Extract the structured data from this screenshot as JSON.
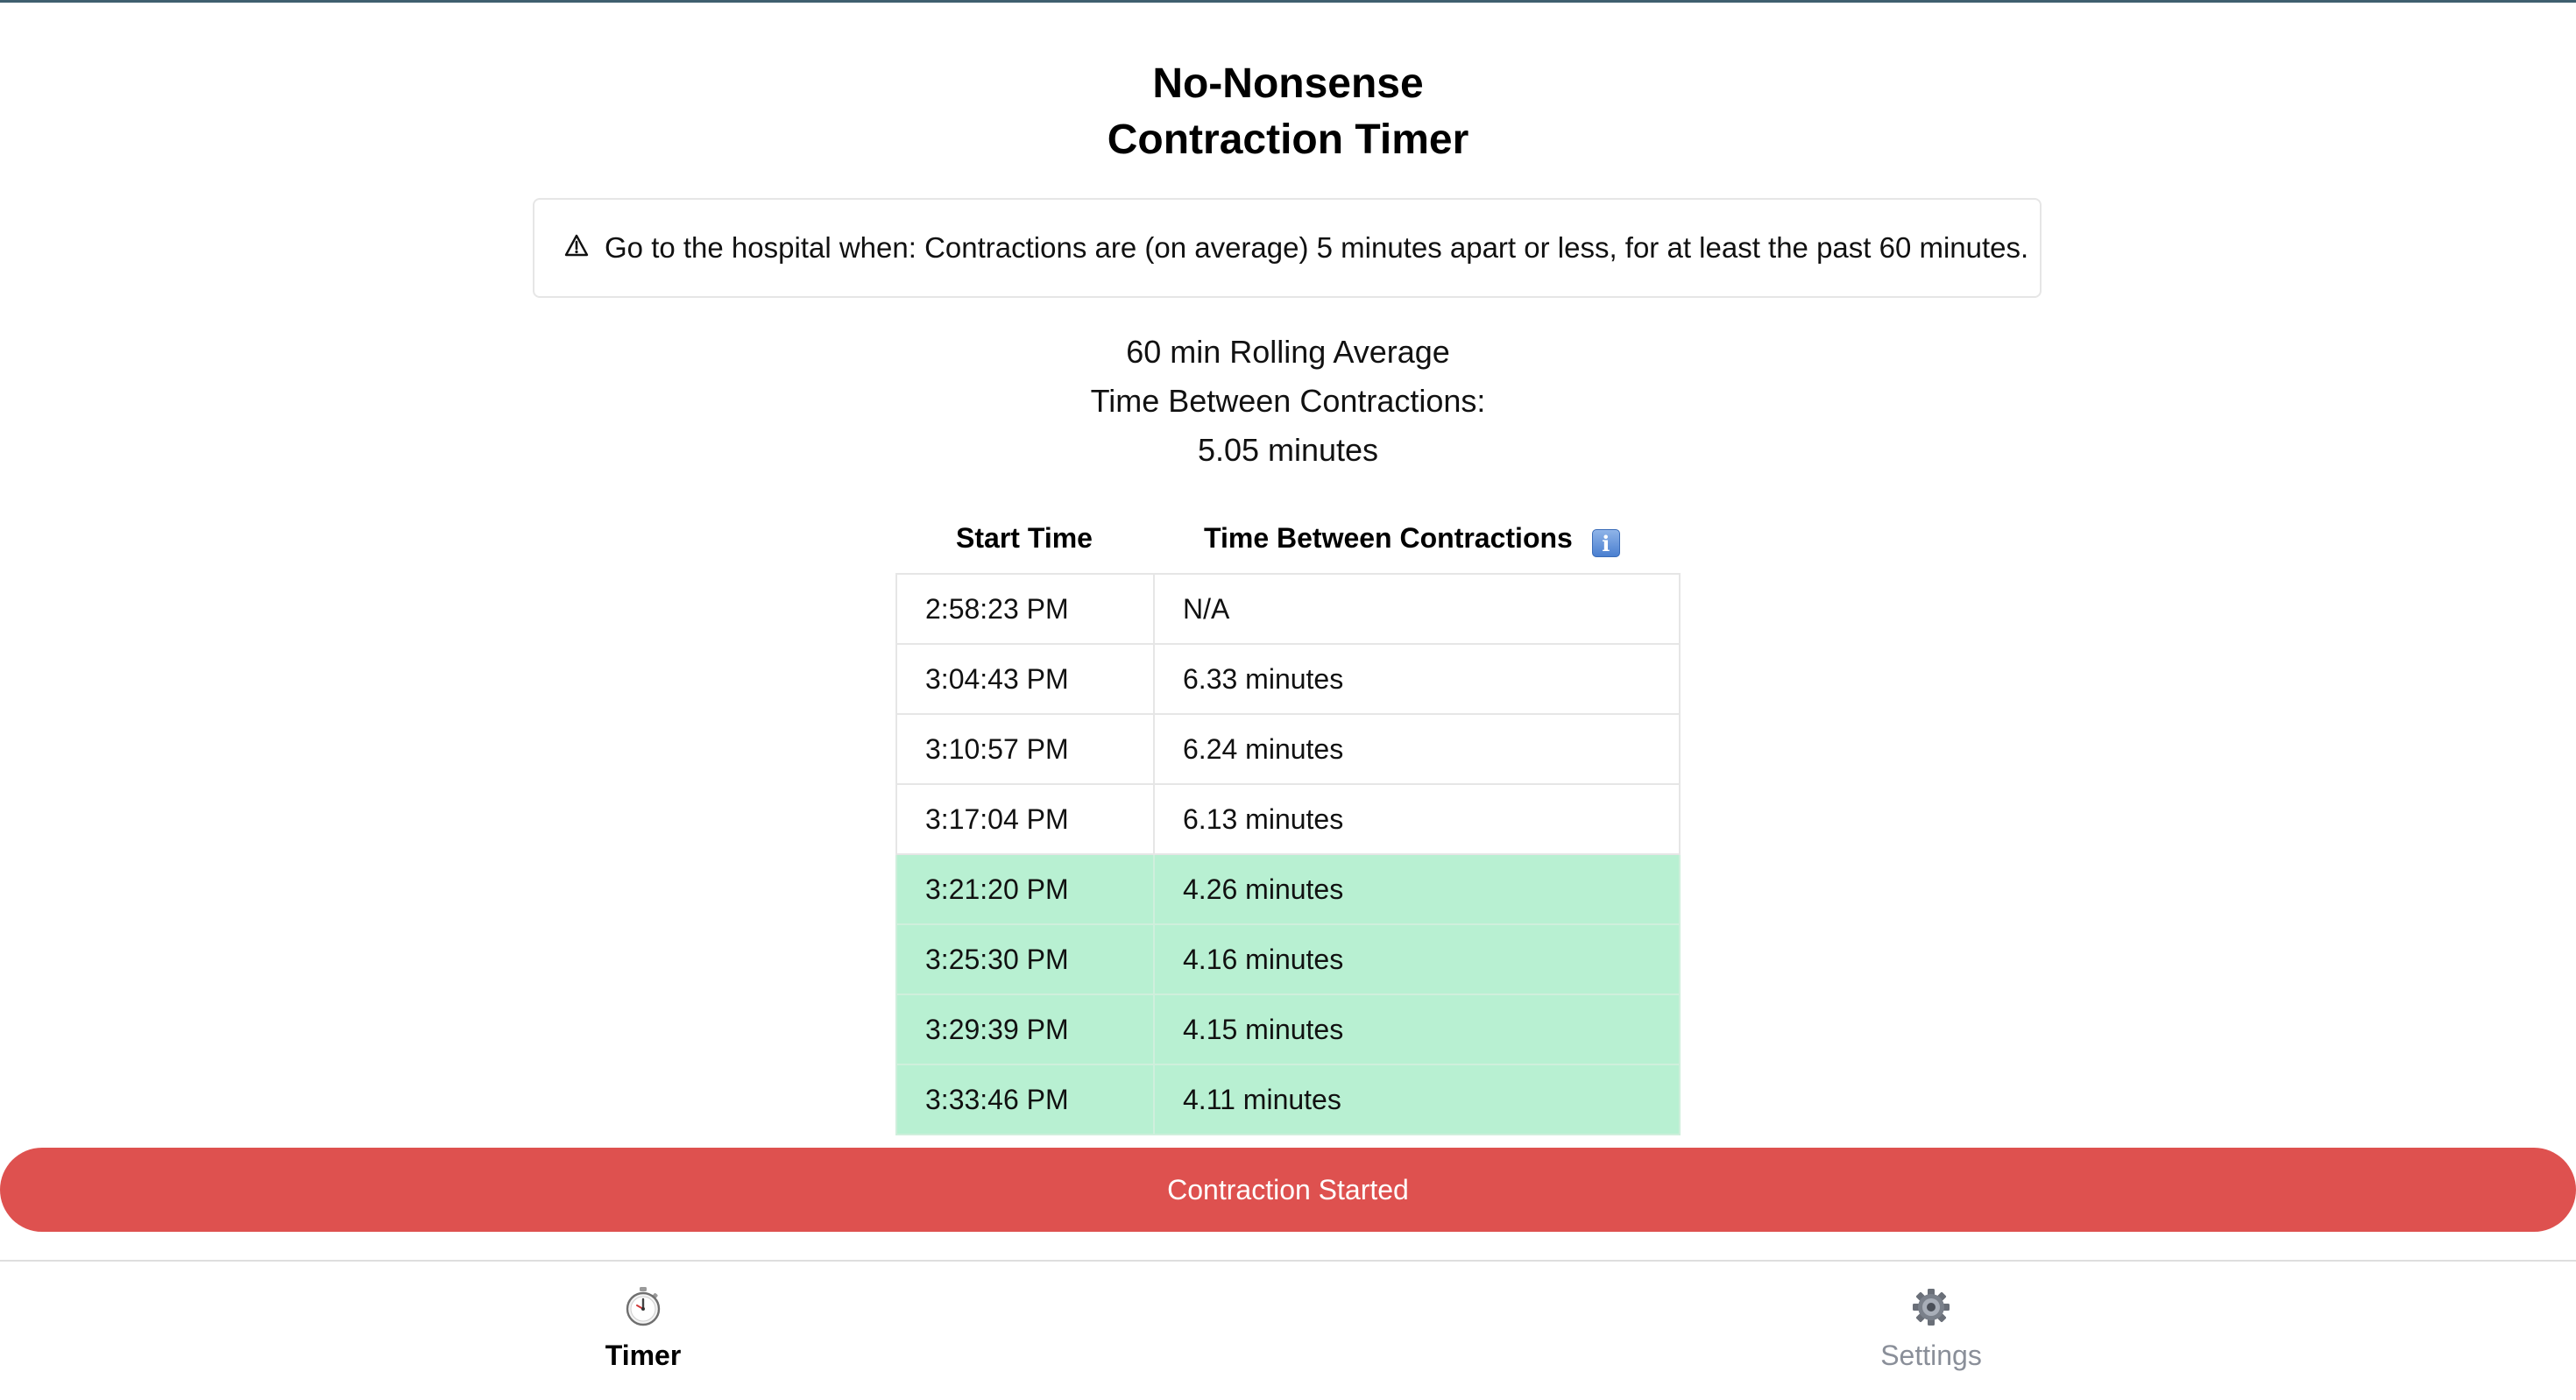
{
  "app": {
    "title_line1": "No-Nonsense",
    "title_line2": "Contraction Timer"
  },
  "alert": {
    "icon": "warning-icon",
    "text": "Go to the hospital when: Contractions are (on average) 5 minutes apart or less, for at least the past 60 minutes."
  },
  "average": {
    "line1": "60 min Rolling Average",
    "line2": "Time Between Contractions:",
    "value": "5.05 minutes"
  },
  "table": {
    "columns": [
      "Start Time",
      "Time Between Contractions"
    ],
    "info_icon": "info-icon",
    "highlight_color": "#b8f0d2",
    "rows": [
      {
        "start": "2:58:23 PM",
        "between": "N/A",
        "highlight": false
      },
      {
        "start": "3:04:43 PM",
        "between": "6.33 minutes",
        "highlight": false
      },
      {
        "start": "3:10:57 PM",
        "between": "6.24 minutes",
        "highlight": false
      },
      {
        "start": "3:17:04 PM",
        "between": "6.13 minutes",
        "highlight": false
      },
      {
        "start": "3:21:20 PM",
        "between": "4.26 minutes",
        "highlight": true
      },
      {
        "start": "3:25:30 PM",
        "between": "4.16 minutes",
        "highlight": true
      },
      {
        "start": "3:29:39 PM",
        "between": "4.15 minutes",
        "highlight": true
      },
      {
        "start": "3:33:46 PM",
        "between": "4.11 minutes",
        "highlight": true
      }
    ]
  },
  "action": {
    "label": "Contraction Started",
    "color": "#de514f"
  },
  "nav": {
    "timer": {
      "label": "Timer",
      "icon": "stopwatch-icon",
      "active": true
    },
    "settings": {
      "label": "Settings",
      "icon": "gear-icon",
      "active": false
    }
  }
}
